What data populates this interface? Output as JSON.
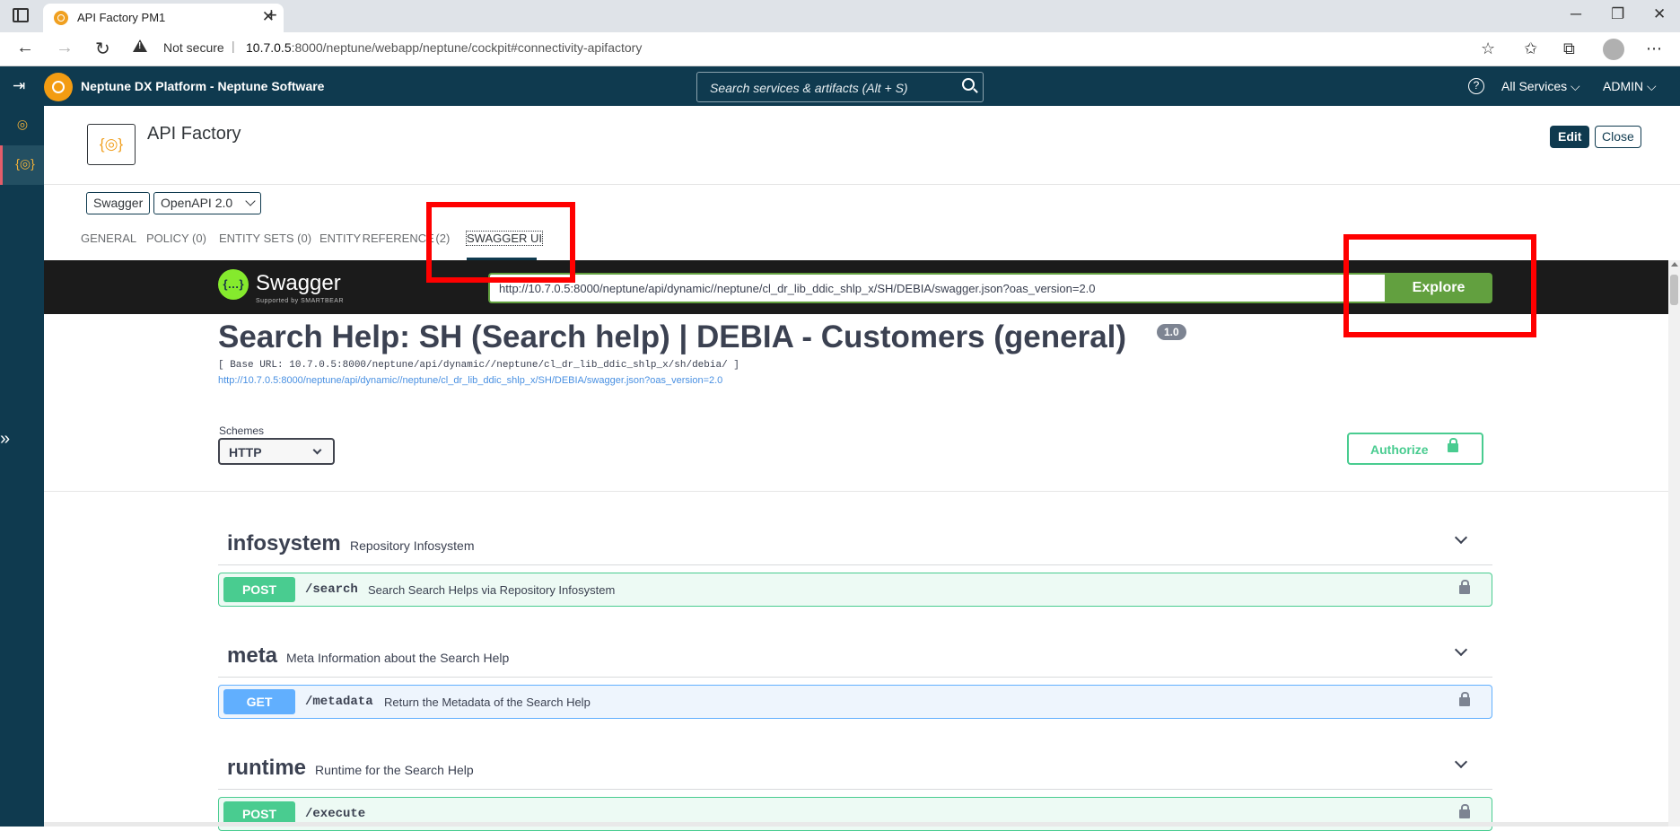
{
  "browser": {
    "tab_title": "API Factory PM1",
    "tab_close": "✕",
    "new_tab": "+",
    "not_secure": "Not secure",
    "url_host": "10.7.0.5",
    "url_rest": ":8000/neptune/webapp/neptune/cockpit#connectivity-apifactory",
    "minimize": "─",
    "restore": "❐",
    "close": "✕"
  },
  "shell": {
    "brand": "Neptune DX Platform  - Neptune Software",
    "search_placeholder": "Search services & artifacts (Alt + S)",
    "help": "?",
    "all_services": "All Services  ⌵",
    "user": "ADMIN  ⌵"
  },
  "page": {
    "title": "API Factory",
    "icon_glyph": "{◎}",
    "edit": "Edit",
    "close": "Close",
    "chip_swagger": "Swagger",
    "chip_openapi": "OpenAPI 2.0",
    "tabs": [
      {
        "label": "GENERAL"
      },
      {
        "label": "POLICY (0)"
      },
      {
        "label": "ENTITY SETS (0)"
      },
      {
        "label": "ENTITY REFERENCE    (2)"
      },
      {
        "label": "SWAGGER UI"
      }
    ]
  },
  "swagger": {
    "logo_glyph": "{…}",
    "name": "Swagger",
    "supported_by": "Supported by SMARTBEAR",
    "spec_url": "http://10.7.0.5:8000/neptune/api/dynamic//neptune/cl_dr_lib_ddic_shlp_x/SH/DEBIA/swagger.json?oas_version=2.0",
    "explore": "Explore",
    "api_title": "Search Help: SH (Search help) | DEBIA - Customers (general)",
    "version": "1.0",
    "base_url": "[ Base URL: 10.7.0.5:8000/neptune/api/dynamic//neptune/cl_dr_lib_ddic_shlp_x/sh/debia/ ]",
    "spec_link": "http://10.7.0.5:8000/neptune/api/dynamic//neptune/cl_dr_lib_ddic_shlp_x/SH/DEBIA/swagger.json?oas_version=2.0",
    "schemes_label": "Schemes",
    "scheme_selected": "HTTP",
    "authorize": "Authorize",
    "tags": [
      {
        "name": "infosystem",
        "description": "Repository Infosystem",
        "ops": [
          {
            "method": "POST",
            "path": "/search",
            "summary": "Search Search Helps via Repository Infosystem"
          }
        ]
      },
      {
        "name": "meta",
        "description": "Meta Information about the Search Help",
        "ops": [
          {
            "method": "GET",
            "path": "/metadata",
            "summary": "Return the Metadata of the Search Help"
          }
        ]
      },
      {
        "name": "runtime",
        "description": "Runtime for the Search Help",
        "ops": [
          {
            "method": "POST",
            "path": "/execute",
            "summary": ""
          }
        ]
      }
    ]
  },
  "colors": {
    "shell_bg": "#0f3a4f",
    "highlight_red": "#ff0000",
    "post_green": "#49cc90",
    "get_blue": "#61affe",
    "explore_green": "#62a03f"
  }
}
